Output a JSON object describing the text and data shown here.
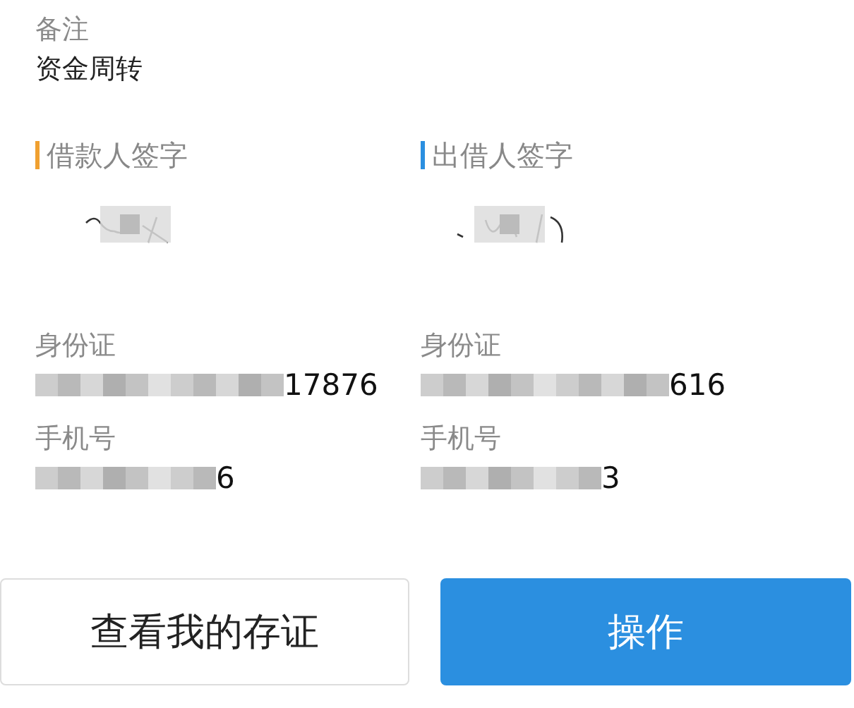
{
  "remark": {
    "label": "备注",
    "value": "资金周转"
  },
  "parties": [
    {
      "title": "借款人签字",
      "color": "#f0a030",
      "id_label": "身份证",
      "id_tail": "17876",
      "phone_label": "手机号",
      "phone_tail": "6"
    },
    {
      "title": "出借人签字",
      "color": "#2b8fe0",
      "id_label": "身份证",
      "id_tail": "616",
      "phone_label": "手机号",
      "phone_tail": "3"
    }
  ],
  "buttons": [
    {
      "label": "查看我的存证",
      "kind": "secondary"
    },
    {
      "label": "操作",
      "kind": "primary"
    }
  ]
}
